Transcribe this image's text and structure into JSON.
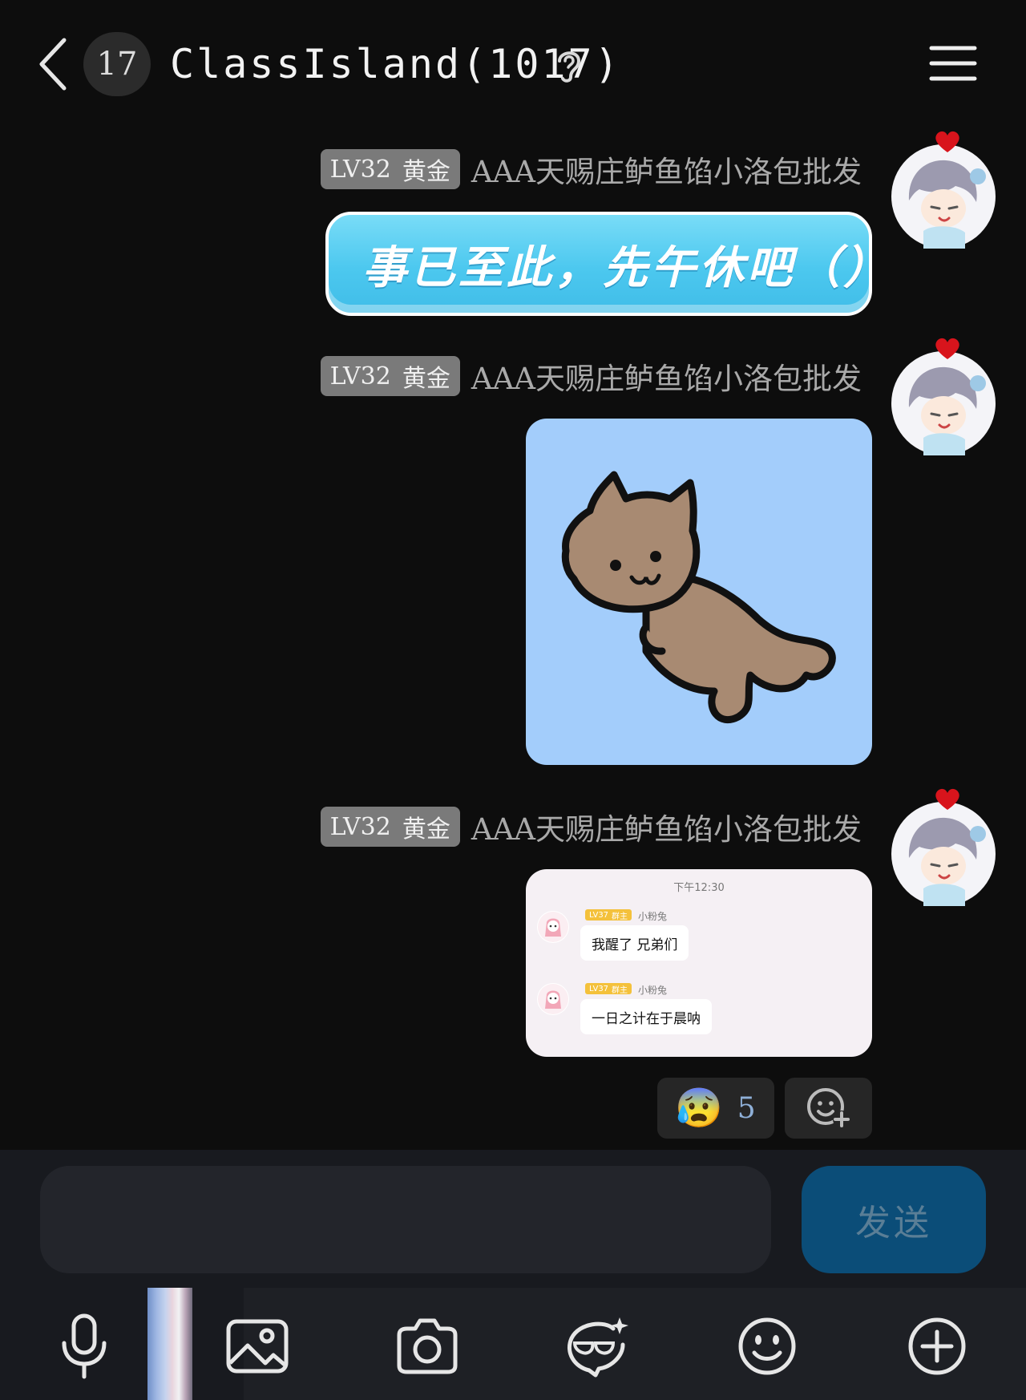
{
  "header": {
    "unread_count": "17",
    "title": "ClassIsland(1017)"
  },
  "messages": [
    {
      "level": "LV32",
      "rank": "黄金",
      "sender": "AAA天赐庄鲈鱼馅小洛包批发",
      "type": "text",
      "text": "事已至此，先午休吧（）"
    },
    {
      "level": "LV32",
      "rank": "黄金",
      "sender": "AAA天赐庄鲈鱼馅小洛包批发",
      "type": "sticker",
      "sticker_icon": "lying-cat-sticker"
    },
    {
      "level": "LV32",
      "rank": "黄金",
      "sender": "AAA天赐庄鲈鱼馅小洛包批发",
      "type": "image",
      "screenshot": {
        "time": "下午12:30",
        "items": [
          {
            "tag_level": "LV37",
            "tag_role": "群主",
            "name": "小粉兔",
            "text": "我醒了 兄弟们"
          },
          {
            "tag_level": "LV37",
            "tag_role": "群主",
            "name": "小粉兔",
            "text": "一日之计在于晨呐"
          }
        ]
      }
    }
  ],
  "reactions": {
    "emoji": "😰",
    "count": "5",
    "add_icon": "add-reaction-icon"
  },
  "input": {
    "value": "",
    "send_label": "发送"
  },
  "toolbar_icons": [
    "microphone-icon",
    "image-icon",
    "camera-icon",
    "sticker-icon",
    "emoji-icon",
    "plus-icon"
  ]
}
